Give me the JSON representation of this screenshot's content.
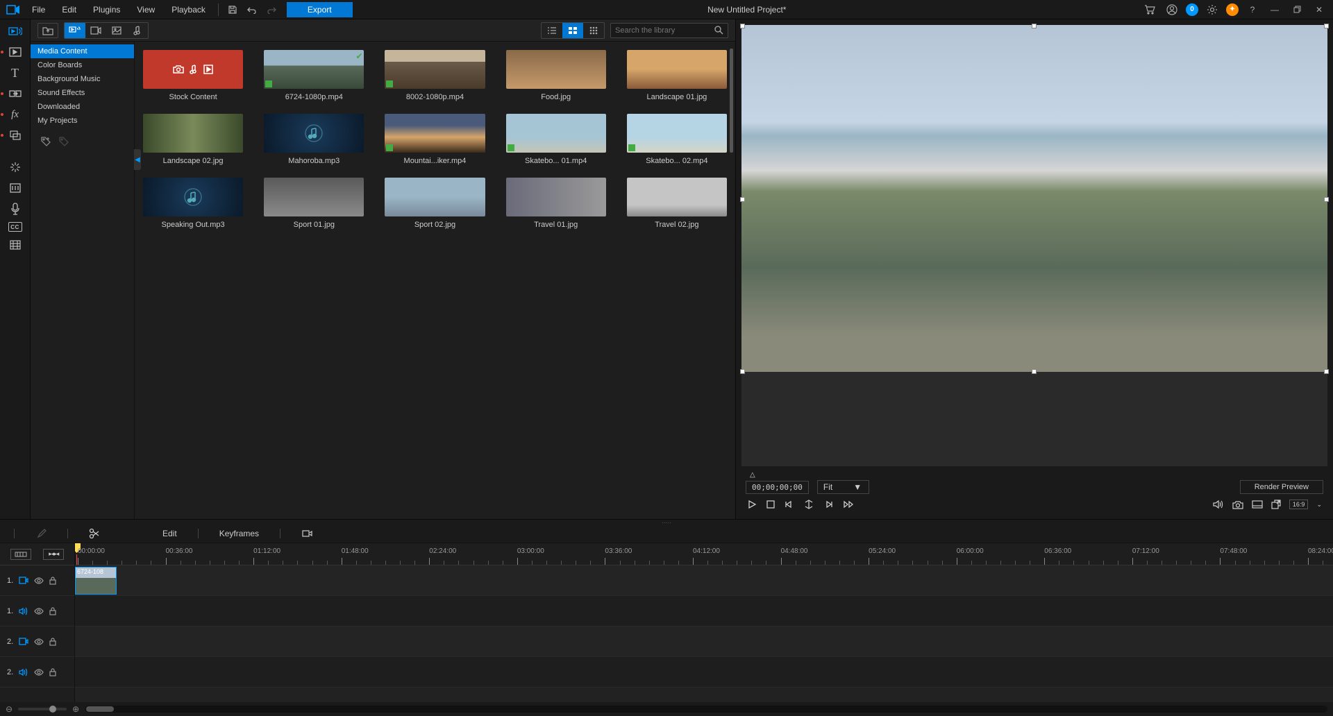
{
  "app": {
    "title": "New Untitled Project*"
  },
  "menu": {
    "file": "File",
    "edit": "Edit",
    "plugins": "Plugins",
    "view": "View",
    "playback": "Playback",
    "export": "Export"
  },
  "library": {
    "search_placeholder": "Search the library",
    "tree": [
      "Media Content",
      "Color Boards",
      "Background Music",
      "Sound Effects",
      "Downloaded",
      "My Projects"
    ],
    "items": [
      {
        "label": "Stock Content",
        "type": "stock"
      },
      {
        "label": "6724-1080p.mp4",
        "type": "video",
        "used": true,
        "thumb": "tg-mountain1"
      },
      {
        "label": "8002-1080p.mp4",
        "type": "video",
        "thumb": "tg-mountain2"
      },
      {
        "label": "Food.jpg",
        "type": "image",
        "thumb": "tg-food"
      },
      {
        "label": "Landscape 01.jpg",
        "type": "image",
        "thumb": "tg-landscape1"
      },
      {
        "label": "Landscape 02.jpg",
        "type": "image",
        "thumb": "tg-forest"
      },
      {
        "label": "Mahoroba.mp3",
        "type": "audio"
      },
      {
        "label": "Mountai...iker.mp4",
        "type": "video",
        "thumb": "tg-sunset"
      },
      {
        "label": "Skatebo... 01.mp4",
        "type": "video",
        "thumb": "tg-skate1"
      },
      {
        "label": "Skatebo... 02.mp4",
        "type": "video",
        "thumb": "tg-skate2"
      },
      {
        "label": "Speaking Out.mp3",
        "type": "audio"
      },
      {
        "label": "Sport 01.jpg",
        "type": "image",
        "thumb": "tg-sport1"
      },
      {
        "label": "Sport 02.jpg",
        "type": "image",
        "thumb": "tg-sport2"
      },
      {
        "label": "Travel 01.jpg",
        "type": "image",
        "thumb": "tg-travel1"
      },
      {
        "label": "Travel 02.jpg",
        "type": "image",
        "thumb": "tg-travel2"
      }
    ]
  },
  "preview": {
    "timecode": "00;00;00;00",
    "fit_label": "Fit",
    "render_label": "Render Preview",
    "aspect": "16:9"
  },
  "timeline": {
    "edit_label": "Edit",
    "keyframes_label": "Keyframes",
    "clip_label": "6724-108",
    "tracks": [
      {
        "label": "1.",
        "type": "video"
      },
      {
        "label": "1.",
        "type": "audio"
      },
      {
        "label": "2.",
        "type": "video"
      },
      {
        "label": "2.",
        "type": "audio"
      }
    ],
    "ruler": [
      "00:00:00",
      "00:36:00",
      "01:12:00",
      "01:48:00",
      "02:24:00",
      "03:00:00",
      "03:36:00",
      "04:12:00",
      "04:48:00",
      "05:24:00",
      "06:00:00",
      "06:36:00",
      "07:12:00",
      "07:48:00",
      "08:24:00"
    ]
  }
}
